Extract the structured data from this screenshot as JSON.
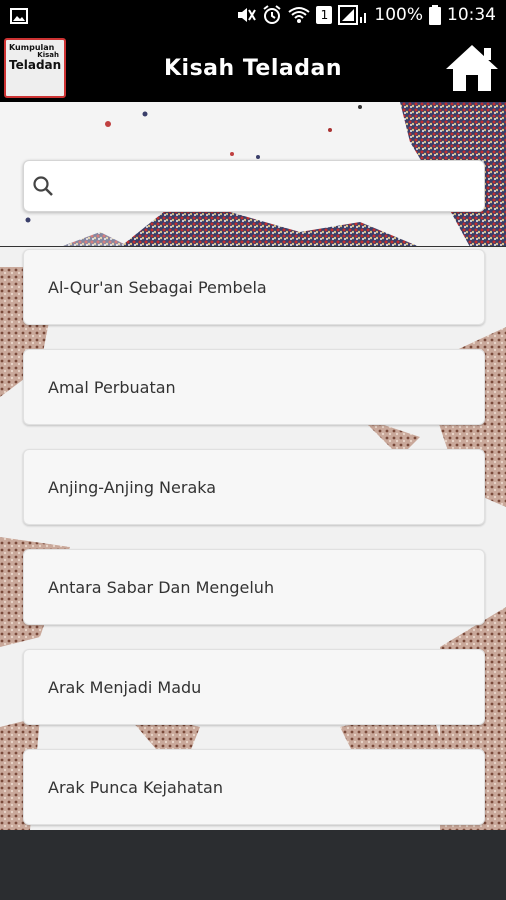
{
  "status_bar": {
    "battery": "100%",
    "time": "10:34",
    "sim_slot": "1",
    "icons": [
      "image-icon",
      "mute-icon",
      "alarm-icon",
      "wifi-icon",
      "sim-icon",
      "signal-icon",
      "battery-icon"
    ]
  },
  "app_bar": {
    "logo_line1": "Kumpulan",
    "logo_line2": "Kisah",
    "logo_line3": "Teladan",
    "title": "Kisah Teladan",
    "home_icon": "home-icon"
  },
  "search": {
    "value": "",
    "placeholder": "",
    "icon": "search-icon"
  },
  "stories": [
    {
      "title": "Al-Qur'an Sebagai Pembela"
    },
    {
      "title": "Amal Perbuatan"
    },
    {
      "title": "Anjing-Anjing Neraka"
    },
    {
      "title": "Antara Sabar Dan Mengeluh"
    },
    {
      "title": "Arak Menjadi Madu"
    },
    {
      "title": "Arak Punca Kejahatan"
    }
  ],
  "colors": {
    "app_bar": "#000000",
    "list_card": "#f7f7f7",
    "crowd_a": "#b08070",
    "crowd_b": "#3a3f6a",
    "bottom_bar": "#2b2d30"
  }
}
